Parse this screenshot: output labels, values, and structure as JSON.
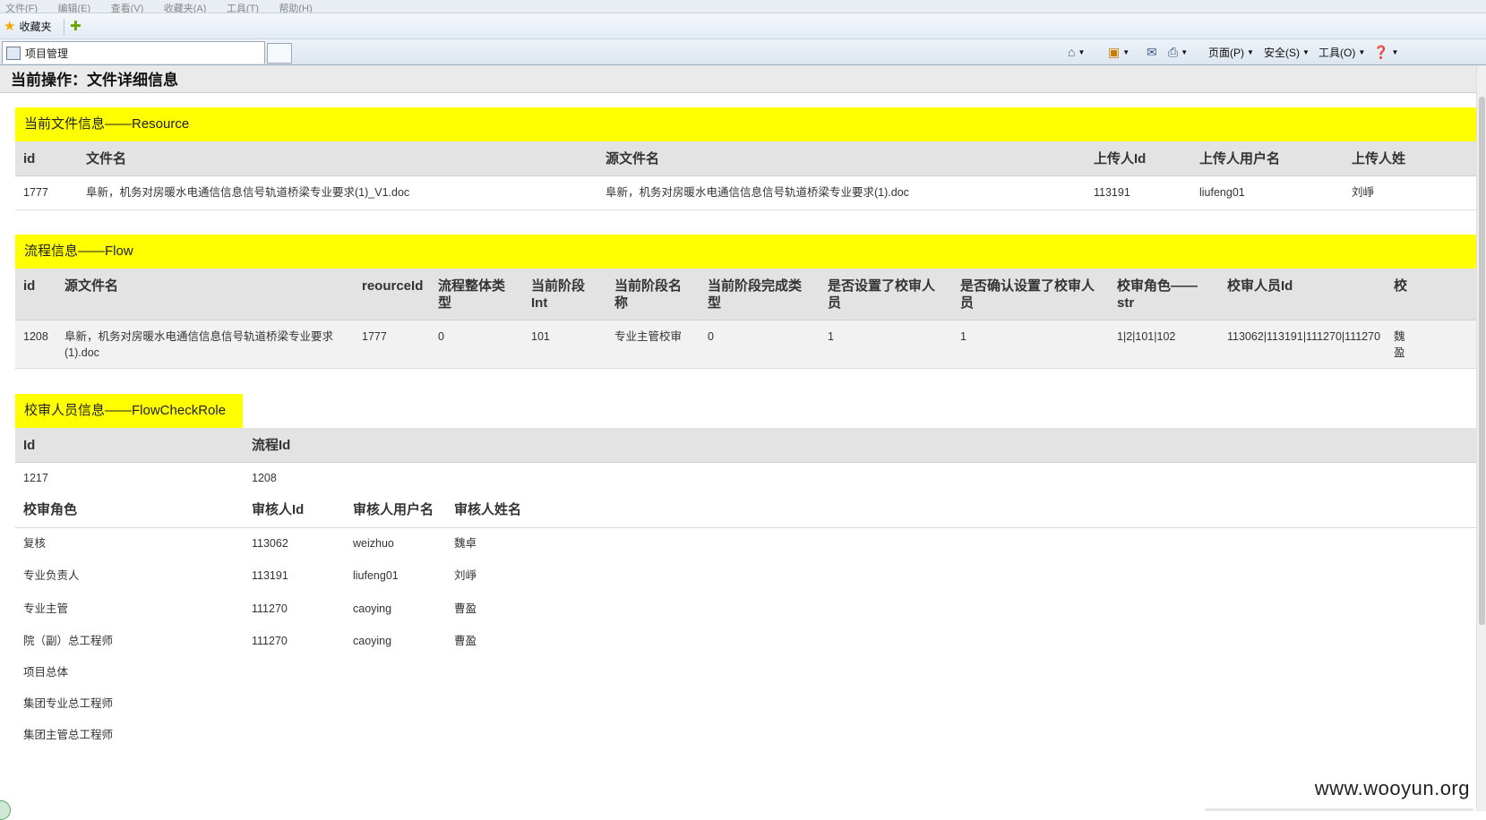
{
  "menu": [
    "文件(F)",
    "编辑(E)",
    "查看(V)",
    "收藏夹(A)",
    "工具(T)",
    "帮助(H)"
  ],
  "favorites": {
    "label": "收藏夹"
  },
  "tab": {
    "title": "项目管理"
  },
  "commands": {
    "page": "页面(P)",
    "safety": "安全(S)",
    "tools": "工具(O)"
  },
  "page_title": "当前操作：文件详细信息",
  "resource": {
    "title": "当前文件信息——Resource",
    "headers": [
      "id",
      "文件名",
      "源文件名",
      "上传人Id",
      "上传人用户名",
      "上传人姓"
    ],
    "row": [
      "1777",
      "阜新，机务对房暖水电通信信息信号轨道桥梁专业要求(1)_V1.doc",
      "阜新，机务对房暖水电通信信息信号轨道桥梁专业要求(1).doc",
      "113191",
      "liufeng01",
      "刘崢"
    ]
  },
  "flow": {
    "title": "流程信息——Flow",
    "headers": [
      "id",
      "源文件名",
      "reourceId",
      "流程整体类型",
      "当前阶段Int",
      "当前阶段名称",
      "当前阶段完成类型",
      "是否设置了校审人员",
      "是否确认设置了校审人员",
      "校审角色——str",
      "校审人员Id",
      "校"
    ],
    "row": [
      "1208",
      "阜新，机务对房暖水电通信信息信号轨道桥梁专业要求(1).doc",
      "1777",
      "0",
      "101",
      "专业主管校审",
      "0",
      "1",
      "1",
      "1|2|101|102",
      "113062|113191|111270|111270",
      "魏盈"
    ]
  },
  "check_role": {
    "title": "校审人员信息——FlowCheckRole",
    "headers": [
      "Id",
      "流程Id"
    ],
    "row": [
      "1217",
      "1208"
    ],
    "sub_headers": [
      "校审角色",
      "审核人Id",
      "审核人用户名",
      "审核人姓名"
    ],
    "rows": [
      [
        "复核",
        "113062",
        "weizhuo",
        "魏卓"
      ],
      [
        "专业负责人",
        "113191",
        "liufeng01",
        "刘崢"
      ],
      [
        "专业主管",
        "111270",
        "caoying",
        "曹盈"
      ],
      [
        "院（副）总工程师",
        "111270",
        "caoying",
        "曹盈"
      ],
      [
        "项目总体",
        "",
        "",
        ""
      ],
      [
        "集团专业总工程师",
        "",
        "",
        ""
      ],
      [
        "集团主管总工程师",
        "",
        "",
        ""
      ]
    ]
  },
  "watermark": "www.wooyun.org"
}
